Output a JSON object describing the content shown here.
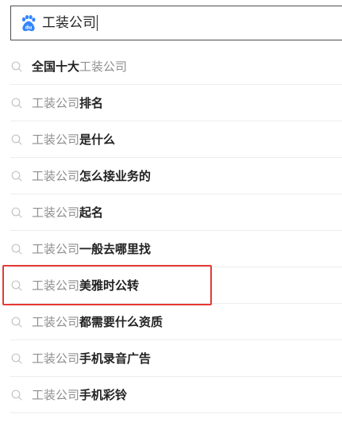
{
  "search": {
    "value": "工装公司",
    "logo_icon": "baidu-paw-icon"
  },
  "colors": {
    "brand_blue": "#3385ff",
    "highlight_red": "#e53935",
    "muted_text": "#8f8f8f",
    "bold_text": "#222222"
  },
  "suggestions": [
    {
      "pre_bold": "全国十大",
      "plain": "工装公司",
      "post_bold": ""
    },
    {
      "pre_bold": "",
      "plain": "工装公司",
      "post_bold": "排名"
    },
    {
      "pre_bold": "",
      "plain": "工装公司",
      "post_bold": "是什么"
    },
    {
      "pre_bold": "",
      "plain": "工装公司",
      "post_bold": "怎么接业务的"
    },
    {
      "pre_bold": "",
      "plain": "工装公司",
      "post_bold": "起名"
    },
    {
      "pre_bold": "",
      "plain": "工装公司",
      "post_bold": "一般去哪里找"
    },
    {
      "pre_bold": "",
      "plain": "工装公司",
      "post_bold": "美雅时公转"
    },
    {
      "pre_bold": "",
      "plain": "工装公司",
      "post_bold": "都需要什么资质"
    },
    {
      "pre_bold": "",
      "plain": "工装公司",
      "post_bold": "手机录音广告"
    },
    {
      "pre_bold": "",
      "plain": "工装公司",
      "post_bold": "手机彩铃"
    }
  ],
  "highlighted_index": 6
}
